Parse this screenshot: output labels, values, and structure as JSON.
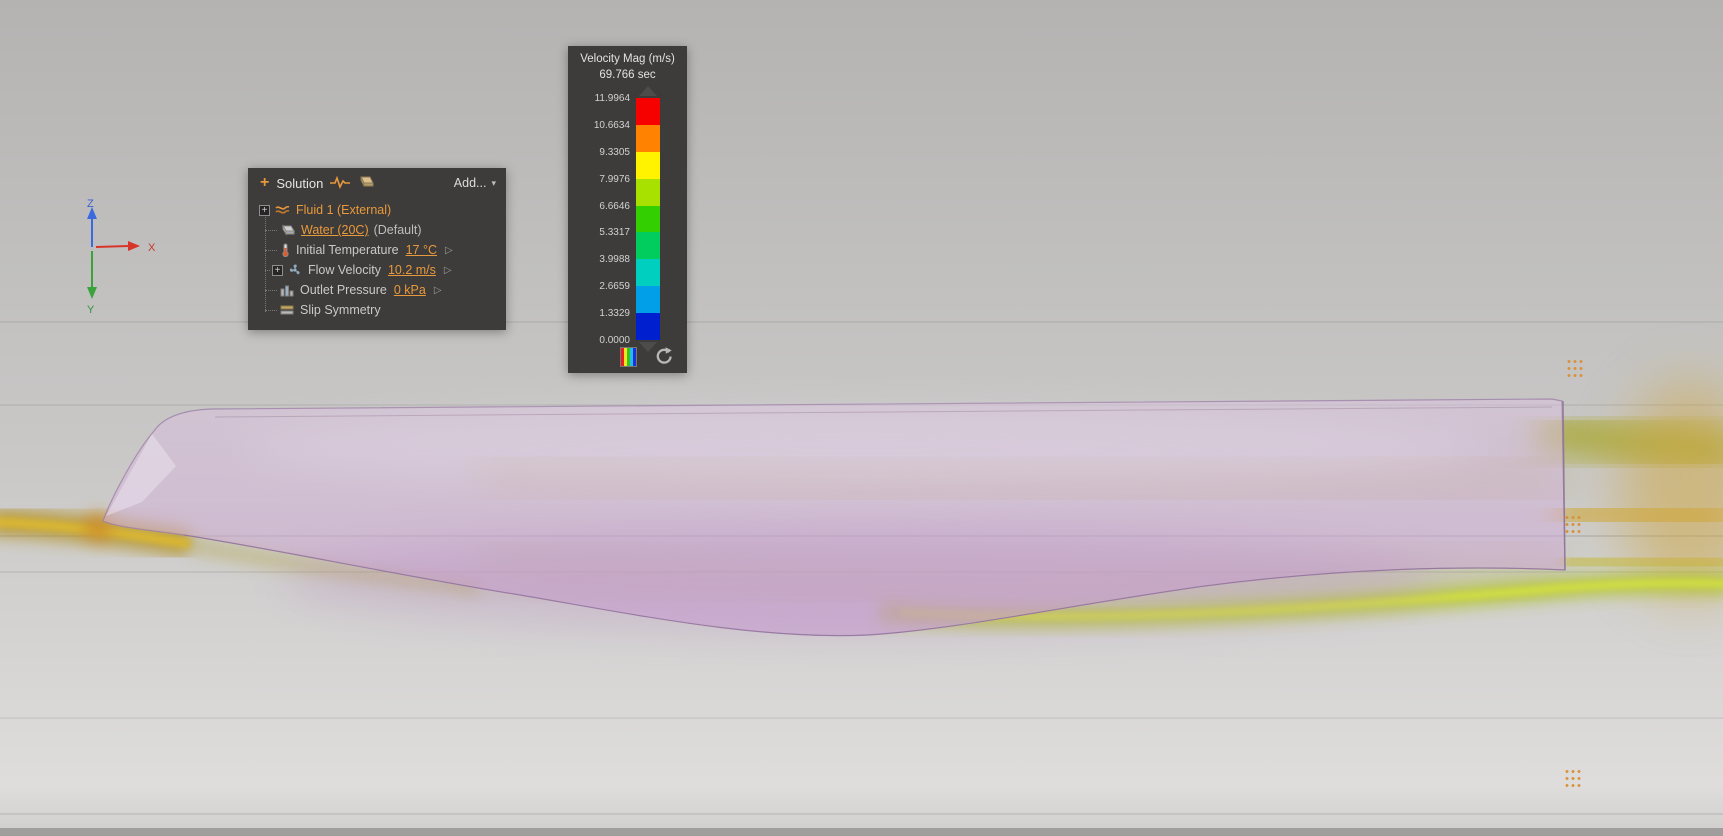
{
  "icons": {
    "expand_plus": "+",
    "add_plus": "+",
    "caret_down": "▾",
    "flyout": "▷"
  },
  "axis_triad": {
    "x_label": "X",
    "y_label": "Y",
    "z_label": "Z"
  },
  "solution_panel": {
    "title": "Solution",
    "add_button": "Add...",
    "items": {
      "fluid": {
        "label": "Fluid 1  (External)"
      },
      "material": {
        "link": "Water (20C)",
        "suffix": "(Default)"
      },
      "temperature": {
        "label": "Initial Temperature",
        "value": "17 °C"
      },
      "velocity": {
        "label": "Flow Velocity",
        "value": "10.2 m/s"
      },
      "pressure": {
        "label": "Outlet Pressure",
        "value": "0 kPa"
      },
      "slip": {
        "label": "Slip Symmetry"
      }
    }
  },
  "legend": {
    "title": "Velocity Mag (m/s)",
    "time": "69.766 sec",
    "ticks": [
      "11.9964",
      "10.6634",
      "9.3305",
      "7.9976",
      "6.6646",
      "5.3317",
      "3.9988",
      "2.6659",
      "1.3329",
      "0.0000"
    ],
    "segment_colors": [
      "#f60000",
      "#ff8200",
      "#fff300",
      "#a8e000",
      "#34cf00",
      "#00cd5d",
      "#00cfc0",
      "#009fe8",
      "#0020cf"
    ]
  },
  "colors": {
    "accent_orange": "#e8993c",
    "panel_bg": "#393837"
  }
}
